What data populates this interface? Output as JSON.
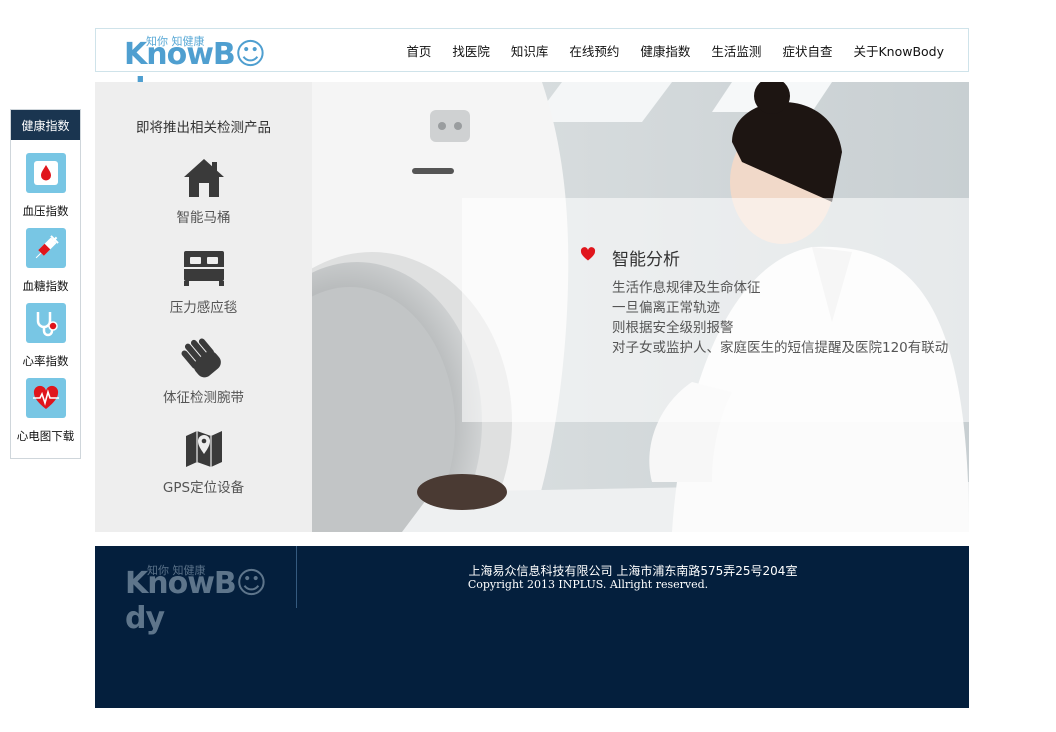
{
  "header": {
    "logo_cn": "知你 知健康",
    "logo_en": "KnowB☺dy",
    "nav": [
      "首页",
      "找医院",
      "知识库",
      "在线预约",
      "健康指数",
      "生活监测",
      "症状自查",
      "关于KnowBody"
    ]
  },
  "sidebar": {
    "title": "健康指数",
    "items": [
      {
        "label": "血压指数",
        "icon": "blood-drop-icon"
      },
      {
        "label": "血糖指数",
        "icon": "syringe-icon"
      },
      {
        "label": "心率指数",
        "icon": "stethoscope-icon"
      },
      {
        "label": "心电图下载",
        "icon": "ecg-heart-icon"
      }
    ]
  },
  "products": {
    "title": "即将推出相关检测产品",
    "items": [
      {
        "label": "智能马桶",
        "icon": "house-icon"
      },
      {
        "label": "压力感应毯",
        "icon": "bed-icon"
      },
      {
        "label": "体征检测腕带",
        "icon": "hand-icon"
      },
      {
        "label": "GPS定位设备",
        "icon": "map-pin-icon"
      }
    ]
  },
  "feature": {
    "title": "智能分析",
    "lines": [
      "生活作息规律及生命体征",
      "一旦偏离正常轨迹",
      "则根据安全级别报警",
      "对子女或监护人、家庭医生的短信提醒及医院120有联动"
    ]
  },
  "footer": {
    "logo_cn": "知你 知健康",
    "logo_en": "KnowB☺dy",
    "address": "上海易众信息科技有限公司 上海市浦东南路575弄25号204室",
    "copyright": "Copyright 2013 INPLUS. Allright reserved."
  },
  "colors": {
    "navy": "#041f3d",
    "side_head": "#1a3550",
    "icon_blue": "#78c6e4",
    "accent_red": "#e0151c"
  }
}
